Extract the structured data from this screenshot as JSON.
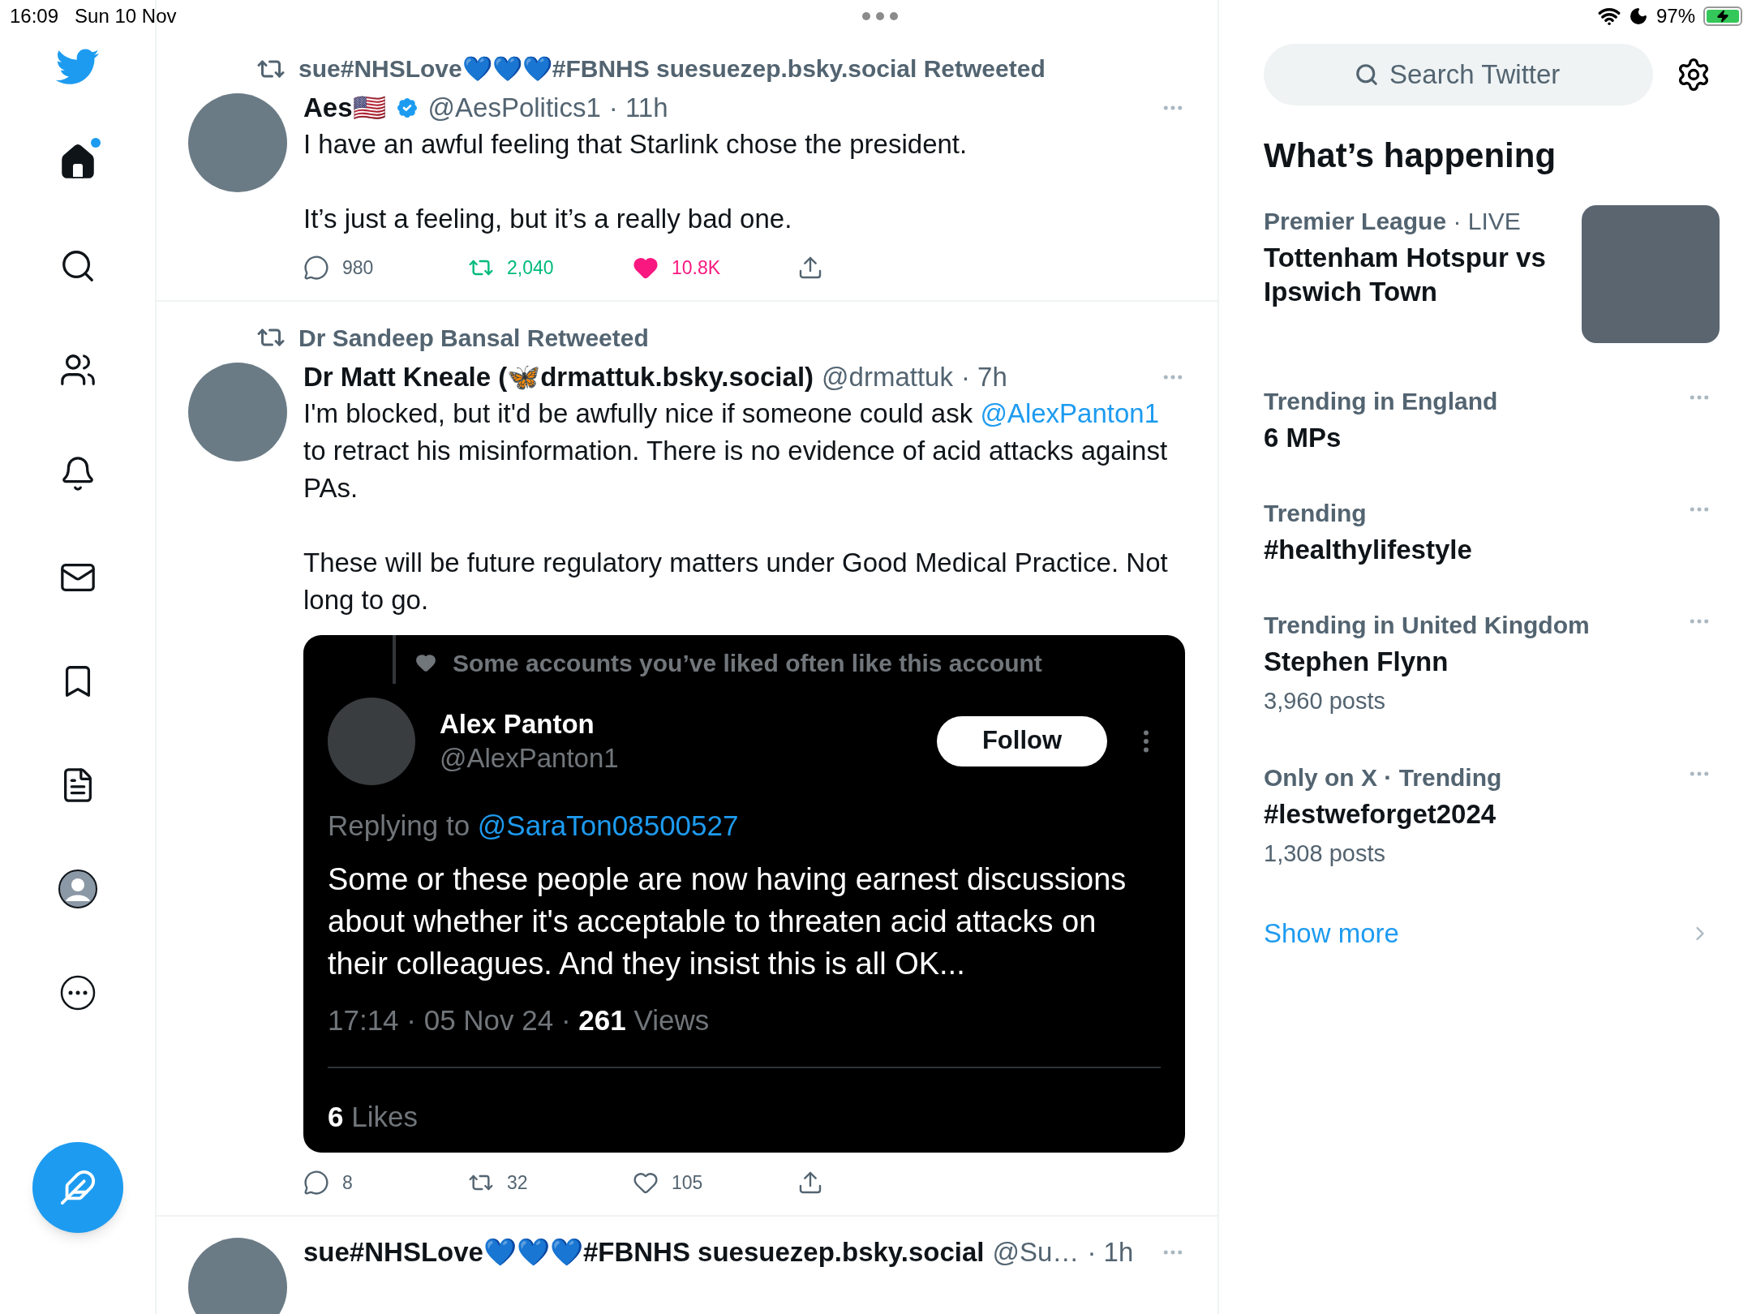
{
  "status_bar": {
    "time": "16:09",
    "date": "Sun 10 Nov",
    "battery": "97%",
    "charging": true
  },
  "nav": {
    "items": [
      {
        "kind": "home",
        "selected": true,
        "dot": true
      },
      {
        "kind": "search",
        "selected": false
      },
      {
        "kind": "communities",
        "selected": false
      },
      {
        "kind": "notifications",
        "selected": false
      },
      {
        "kind": "messages",
        "selected": false
      },
      {
        "kind": "bookmarks",
        "selected": false
      },
      {
        "kind": "lists",
        "selected": false
      },
      {
        "kind": "profile",
        "selected": false
      },
      {
        "kind": "more",
        "selected": false
      }
    ]
  },
  "tweets": [
    {
      "retweeted_by": "sue#NHSLove💙💙💙#FBNHS suesuezep.bsky.social Retweeted",
      "name": "Aes🇺🇸",
      "verified": true,
      "handle": "@AesPolitics1",
      "time": "· 11h",
      "paragraphs": [
        [
          {
            "kind": "text",
            "text": "I have an awful feeling that Starlink chose the president."
          }
        ],
        [
          {
            "kind": "text",
            "text": "It’s just a feeling, but it’s a really bad one."
          }
        ]
      ],
      "replies": "980",
      "retweets": "2,040",
      "retweeted": true,
      "likes": "10.8K",
      "liked": true
    },
    {
      "retweeted_by": "Dr Sandeep Bansal Retweeted",
      "name": "Dr Matt Kneale (🦋drmattuk.bsky.social)",
      "handle": "@drmattuk",
      "time": "· 7h",
      "paragraphs": [
        [
          {
            "kind": "text",
            "text": "I'm blocked, but it'd be awfully nice if someone could ask "
          },
          {
            "kind": "link",
            "text": "@AlexPanton1"
          },
          {
            "kind": "text",
            "text": " to retract his misinformation. There is no evidence of acid attacks against PAs."
          }
        ],
        [
          {
            "kind": "text",
            "text": "These will be future regulatory matters under Good Medical Practice. Not long to go."
          }
        ]
      ],
      "quote": {
        "context": "Some accounts you’ve liked often like this account",
        "name": "Alex Panton",
        "handle": "@AlexPanton1",
        "follow": "Follow",
        "replying_label": "Replying to",
        "replying_to": "@SaraTon08500527",
        "text": "Some or these people are now having earnest discussions about whether it's acceptable to threaten acid attacks on their colleagues. And they insist this is all OK...",
        "meta": "17:14 · 05 Nov 24 · ",
        "views": "261",
        "views_label": "Views",
        "likes": "6",
        "likes_label": "Likes"
      },
      "replies": "8",
      "retweets": "32",
      "retweeted": false,
      "likes": "105",
      "liked": false
    },
    {
      "name": "sue#NHSLove💙💙💙#FBNHS suesuezep.bsky.social",
      "handle": "@Su…",
      "time": "· 1h"
    }
  ],
  "sidebar": {
    "search": {
      "placeholder": "Search Twitter"
    },
    "heading": "What’s happening",
    "trends": [
      {
        "kind": "image",
        "meta": "Premier League",
        "live": "· LIVE",
        "title": "Tottenham Hotspur vs Ipswich Town"
      },
      {
        "kind": "plain",
        "meta": "Trending in England",
        "title": "6 MPs"
      },
      {
        "kind": "plain",
        "meta": "Trending",
        "title": "#healthylifestyle"
      },
      {
        "kind": "plain",
        "meta": "Trending in United Kingdom",
        "title": "Stephen Flynn",
        "posts": "3,960 posts"
      },
      {
        "kind": "plain",
        "meta": "Only on X · Trending",
        "title": "#lestweforget2024",
        "posts": "1,308 posts"
      }
    ],
    "show_more": "Show more"
  }
}
